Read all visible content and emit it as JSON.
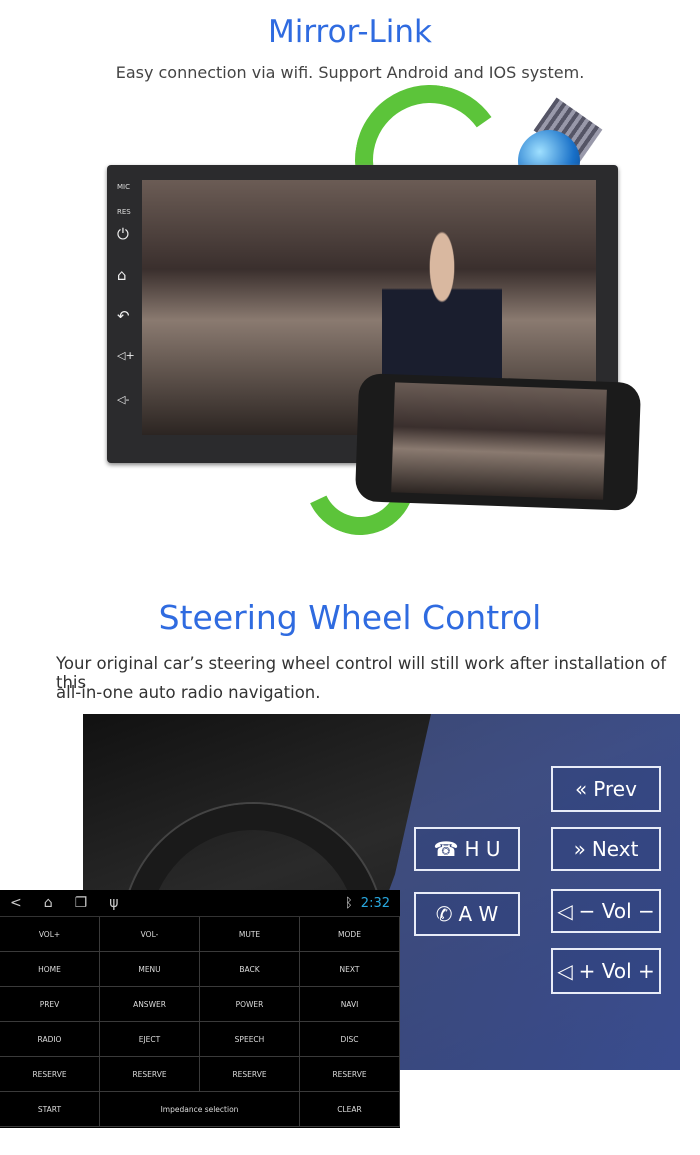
{
  "mirror": {
    "title": "Mirror-Link",
    "subtitle": "Easy connection via wifi. Support Android and IOS system.",
    "unit_labels": {
      "mic": "MIC",
      "res": "RES"
    }
  },
  "steering": {
    "title": "Steering Wheel Control",
    "line1": "Your original car’s steering wheel control will still work after installation of this",
    "line2": "all-in-one auto radio navigation.",
    "controls": [
      {
        "icon": "rewind-icon",
        "glyph": "«",
        "label": "Prev"
      },
      {
        "icon": "hangup-icon",
        "glyph": "☎",
        "label": "H U"
      },
      {
        "icon": "forward-icon",
        "glyph": "»",
        "label": "Next"
      },
      {
        "icon": "answer-icon",
        "glyph": "✆",
        "label": "A W"
      },
      {
        "icon": "speaker-icon",
        "glyph": "◁",
        "label": "− Vol −"
      },
      {
        "icon": "speaker-icon",
        "glyph": "◁",
        "label": "+ Vol +"
      }
    ]
  },
  "android": {
    "time": "2:32",
    "time_color": "#29a8e0",
    "keys": [
      "VOL+",
      "VOL-",
      "MUTE",
      "MODE",
      "HOME",
      "MENU",
      "BACK",
      "NEXT",
      "PREV",
      "ANSWER",
      "POWER",
      "NAVI",
      "RADIO",
      "EJECT",
      "SPEECH",
      "DISC",
      "RESERVE",
      "RESERVE",
      "RESERVE",
      "RESERVE",
      "START",
      "Impedance selection",
      "CLEAR"
    ]
  },
  "colors": {
    "title": "#2f6be0",
    "arrow": "#5cc43a"
  }
}
